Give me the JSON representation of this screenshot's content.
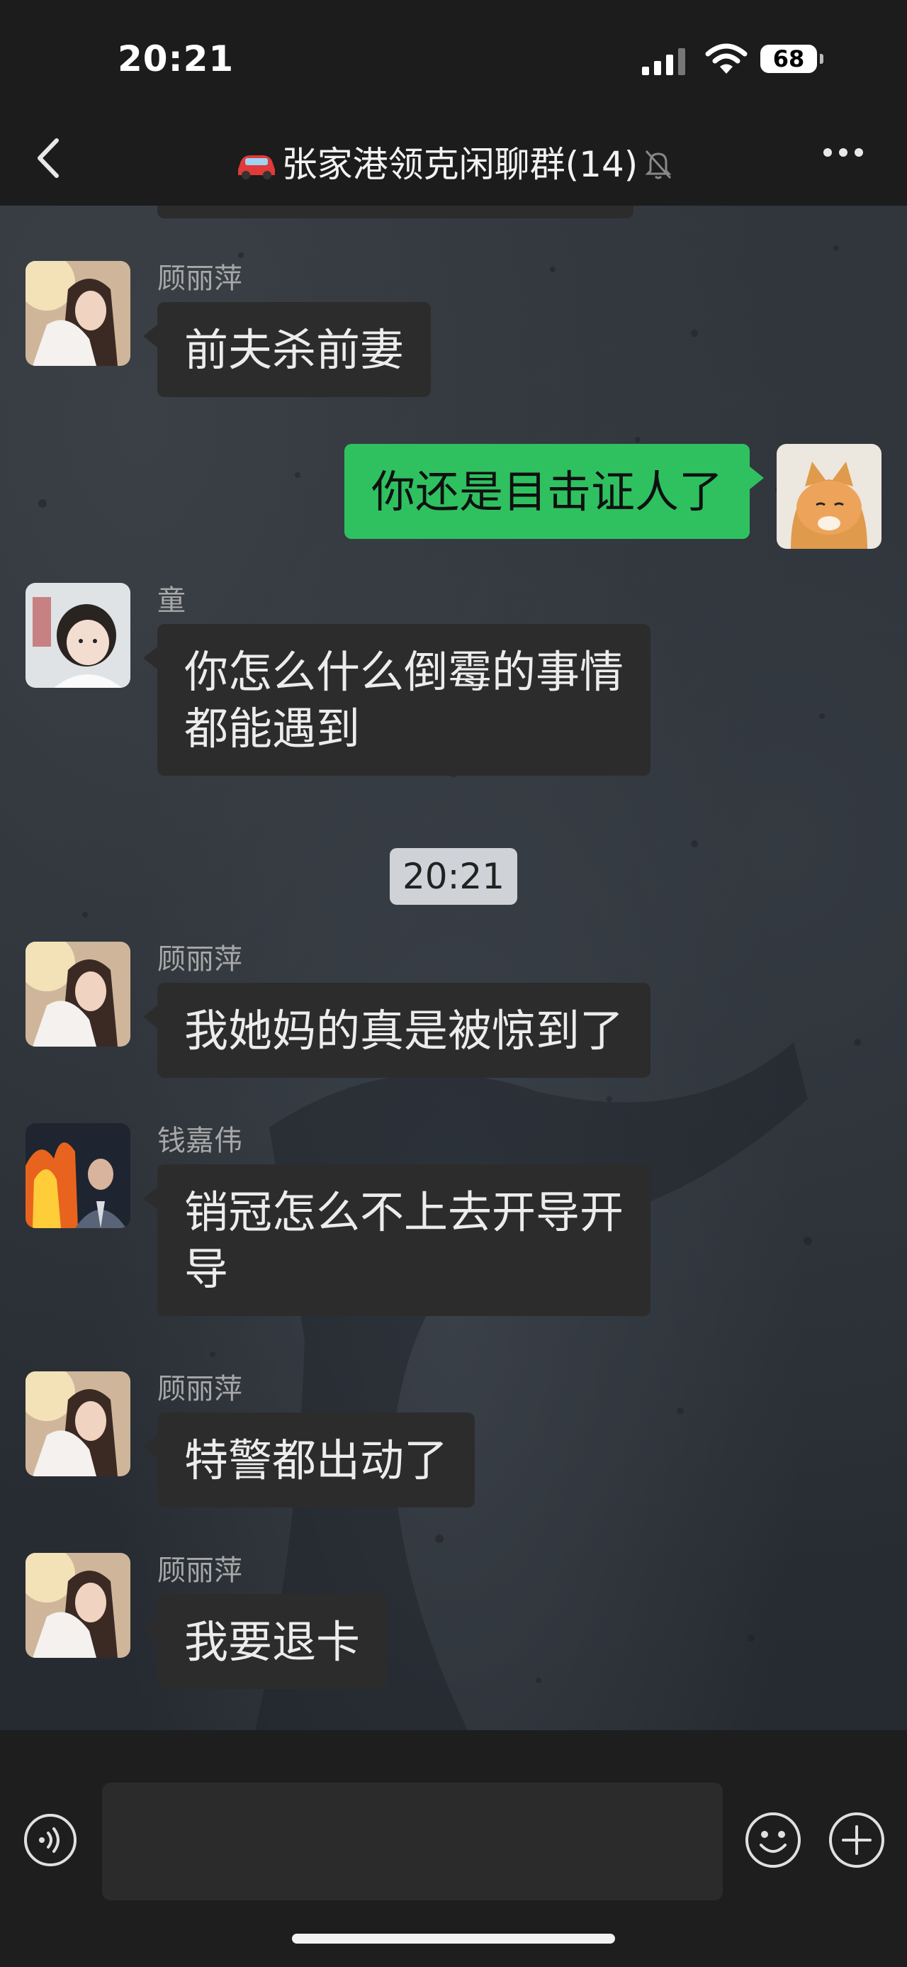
{
  "status_bar": {
    "time": "20:21",
    "battery": "68"
  },
  "header": {
    "back_icon": "chevron-left-icon",
    "title_emoji": "car-icon",
    "title": "张家港领克闲聊群(14)",
    "mute_icon": "bell-slash-icon",
    "more_icon": "more-dots-icon"
  },
  "messages": [
    {
      "sender": "顾丽萍",
      "text": "前夫杀前妻",
      "avatar": "woman-photo-avatar"
    },
    {
      "sender": "",
      "text": "你还是目击证人了",
      "self": true,
      "avatar": "cat-photo-avatar"
    },
    {
      "sender": "童",
      "text": "你怎么什么倒霉的事情都能遇到",
      "line1": "你怎么什么倒霉的事情",
      "line2": "都能遇到",
      "avatar": "child-photo-avatar"
    },
    {
      "sender": "顾丽萍",
      "text": "我她妈的真是被惊到了",
      "avatar": "woman-photo-avatar"
    },
    {
      "sender": "钱嘉伟",
      "text": "销冠怎么不上去开导开导",
      "line1": "销冠怎么不上去开导开",
      "line2": "导",
      "avatar": "fire-man-avatar"
    },
    {
      "sender": "顾丽萍",
      "text": "特警都出动了",
      "avatar": "woman-photo-avatar"
    },
    {
      "sender": "顾丽萍",
      "text": "我要退卡",
      "avatar": "woman-photo-avatar"
    }
  ],
  "timestamp_divider": "20:21",
  "input_bar": {
    "voice_icon": "voice-icon",
    "emoji_icon": "emoji-icon",
    "plus_icon": "plus-icon",
    "input_value": ""
  },
  "colors": {
    "self_bubble": "#2fc160",
    "other_bubble": "#2c2c2c",
    "bar_background": "#1c1c1c"
  }
}
